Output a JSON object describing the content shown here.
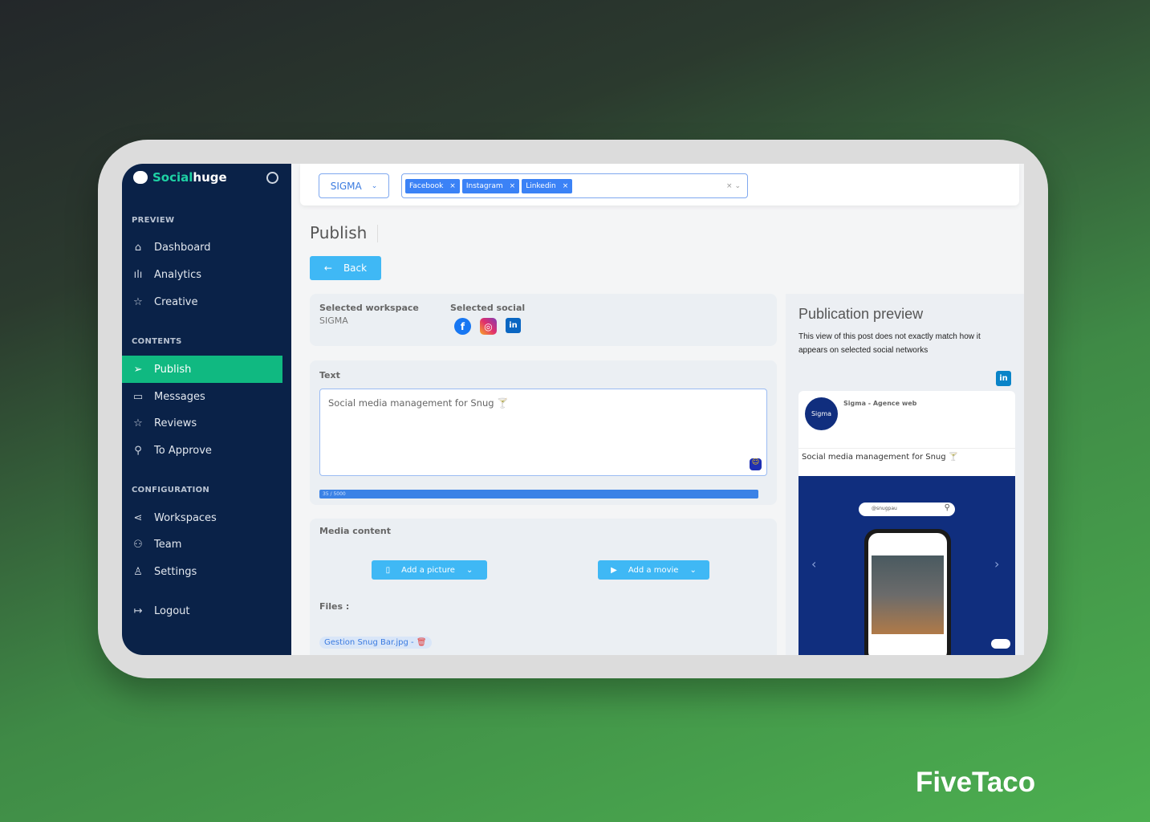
{
  "brand": {
    "logo_a": "Social",
    "logo_b": "huge",
    "watermark": "FiveTaco"
  },
  "sidebar": {
    "sections": [
      "PREVIEW",
      "CONTENTS",
      "CONFIGURATION"
    ],
    "items": [
      {
        "label": "Dashboard",
        "icon": "home-icon"
      },
      {
        "label": "Analytics",
        "icon": "bar-chart-icon"
      },
      {
        "label": "Creative",
        "icon": "star-icon"
      },
      {
        "label": "Publish",
        "icon": "send-icon",
        "active": true
      },
      {
        "label": "Messages",
        "icon": "message-icon"
      },
      {
        "label": "Reviews",
        "icon": "star-icon"
      },
      {
        "label": "To Approve",
        "icon": "search-icon"
      },
      {
        "label": "Workspaces",
        "icon": "share-icon"
      },
      {
        "label": "Team",
        "icon": "users-icon"
      },
      {
        "label": "Settings",
        "icon": "user-icon"
      },
      {
        "label": "Logout",
        "icon": "logout-icon"
      }
    ]
  },
  "topbar": {
    "workspace": "SIGMA",
    "tags": [
      "Facebook",
      "Instagram",
      "Linkedin"
    ]
  },
  "main": {
    "title": "Publish",
    "back": "Back",
    "workspace_label": "Selected workspace",
    "workspace_value": "SIGMA",
    "social_label": "Selected social",
    "text_label": "Text",
    "text_value": "Social media management for Snug 🍸",
    "counter": "35 / 5000",
    "counter_fraction": 0.007,
    "media_label": "Media content",
    "add_picture": "Add a picture",
    "add_movie": "Add a movie",
    "files_label": "Files :",
    "file_name": "Gestion Snug Bar.jpg -"
  },
  "preview": {
    "title": "Publication preview",
    "note": "This view of this post does not exactly match how it appears on selected social networks",
    "account": "Sigma - Agence web",
    "avatar_text": "Sigma",
    "post_text": "Social media management for Snug 🍸",
    "search_handle": "@snugpau"
  },
  "colors": {
    "sidebar": "#0a2248",
    "active": "#10b981",
    "accent": "#3fb8f5",
    "facebook": "#1877f2",
    "linkedin": "#0a66c2"
  }
}
